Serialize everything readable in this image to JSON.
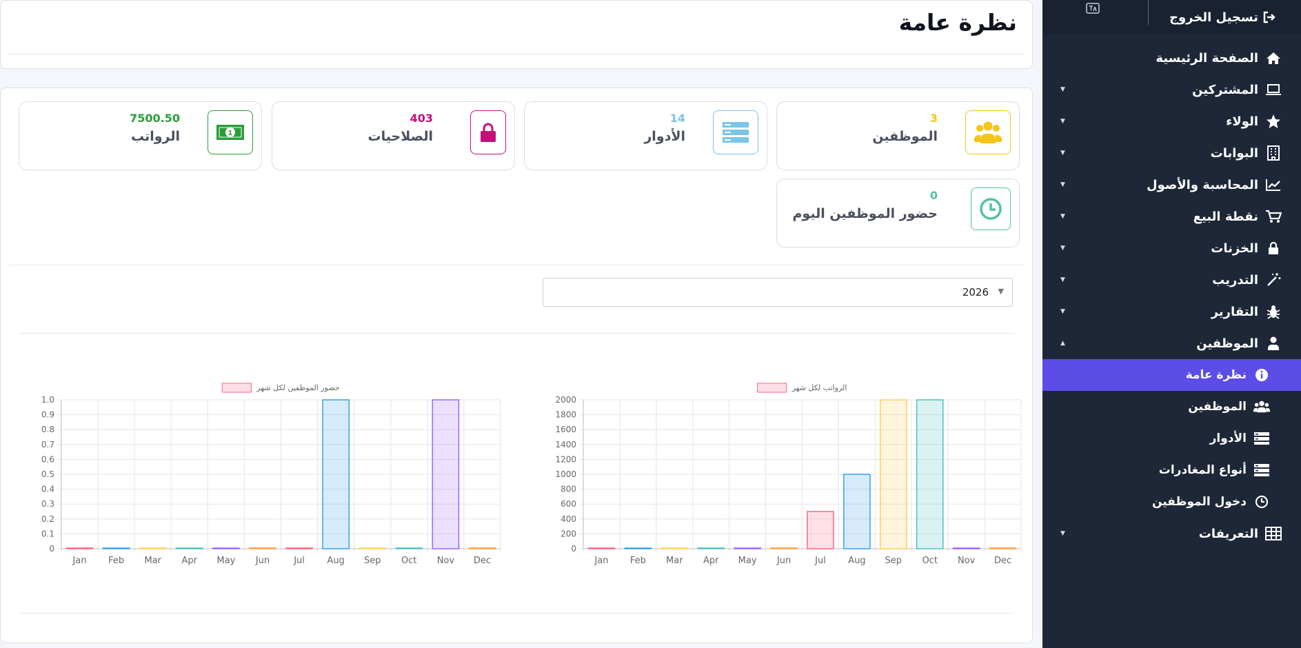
{
  "sidebar": {
    "logout_label": "تسجيل الخروج",
    "items": [
      {
        "label": "الصفحة الرئيسية",
        "icon": "home-icon",
        "caret": ""
      },
      {
        "label": "المشتركين",
        "icon": "laptop-icon",
        "caret": "▼"
      },
      {
        "label": "الولاء",
        "icon": "star-icon",
        "caret": "▼"
      },
      {
        "label": "البوابات",
        "icon": "building-icon",
        "caret": "▼"
      },
      {
        "label": "المحاسبة والأصول",
        "icon": "chart-line-icon",
        "caret": "▼"
      },
      {
        "label": "نقطة البيع",
        "icon": "cart-icon",
        "caret": "▼"
      },
      {
        "label": "الخزنات",
        "icon": "lock-icon",
        "caret": "▼"
      },
      {
        "label": "التدريب",
        "icon": "magic-wand-icon",
        "caret": "▼"
      },
      {
        "label": "التقارير",
        "icon": "bug-icon",
        "caret": "▼"
      },
      {
        "label": "الموظفين",
        "icon": "user-icon",
        "caret": "▲"
      }
    ],
    "sub_items": [
      {
        "label": "نظرة عامة",
        "icon": "info-icon",
        "active": true
      },
      {
        "label": "الموظفين",
        "icon": "users-icon",
        "active": false
      },
      {
        "label": "الأدوار",
        "icon": "list-icon",
        "active": false
      },
      {
        "label": "أنواع المغادرات",
        "icon": "list-icon",
        "active": false
      },
      {
        "label": "دخول الموظفين",
        "icon": "clock-icon",
        "active": false
      }
    ],
    "last_item": {
      "label": "التعريفات",
      "icon": "table-icon",
      "caret": "▼"
    }
  },
  "page": {
    "title": "نظرة عامة"
  },
  "stats": [
    {
      "value": "3",
      "label": "الموظفين",
      "color": "#f5c518",
      "icon": "users-icon"
    },
    {
      "value": "14",
      "label": "الأدوار",
      "color": "#7cc4e8",
      "icon": "server-list-icon"
    },
    {
      "value": "403",
      "label": "الصلاحيات",
      "color": "#c0127a",
      "icon": "lock-icon"
    },
    {
      "value": "7500.50",
      "label": "الرواتب",
      "color": "#2a9d3a",
      "icon": "money-icon"
    },
    {
      "value": "0",
      "label": "حضور الموظفين اليوم",
      "color": "#52c49a",
      "icon": "clock-icon"
    }
  ],
  "year_select": {
    "value": "2026"
  },
  "chart_data": [
    {
      "type": "bar",
      "legend": "الرواتب لكل شهر",
      "categories": [
        "Jan",
        "Feb",
        "Mar",
        "Apr",
        "May",
        "Jun",
        "Jul",
        "Aug",
        "Sep",
        "Oct",
        "Nov",
        "Dec"
      ],
      "values": [
        0,
        0,
        0,
        0,
        0,
        0,
        500,
        1000,
        2000,
        2000,
        0,
        0
      ],
      "ylim": [
        0,
        2000
      ],
      "yticks": [
        0,
        200,
        400,
        600,
        800,
        1000,
        1200,
        1400,
        1600,
        1800,
        2000
      ],
      "grid": true,
      "colors": [
        "#ff6384",
        "#36a2eb",
        "#ffce56",
        "#4bc0c0",
        "#9966ff",
        "#ff9f40",
        "#ff6384",
        "#36a2eb",
        "#ffce56",
        "#4bc0c0",
        "#9966ff",
        "#ff9f40"
      ]
    },
    {
      "type": "bar",
      "legend": "حضور الموظفين لكل شهر",
      "categories": [
        "Jan",
        "Feb",
        "Mar",
        "Apr",
        "May",
        "Jun",
        "Jul",
        "Aug",
        "Sep",
        "Oct",
        "Nov",
        "Dec"
      ],
      "values": [
        0,
        0,
        0,
        0,
        0,
        0,
        0,
        1,
        0,
        0,
        1,
        0
      ],
      "ylim": [
        0,
        1
      ],
      "yticks": [
        "0",
        "0.1",
        "0.2",
        "0.3",
        "0.4",
        "0.5",
        "0.6",
        "0.7",
        "0.8",
        "0.9",
        "1.0"
      ],
      "grid": true,
      "colors": [
        "#ff6384",
        "#36a2eb",
        "#ffce56",
        "#4bc0c0",
        "#9966ff",
        "#ff9f40",
        "#ff6384",
        "#36a2eb",
        "#ffce56",
        "#4bc0c0",
        "#9966ff",
        "#ff9f40"
      ]
    }
  ]
}
